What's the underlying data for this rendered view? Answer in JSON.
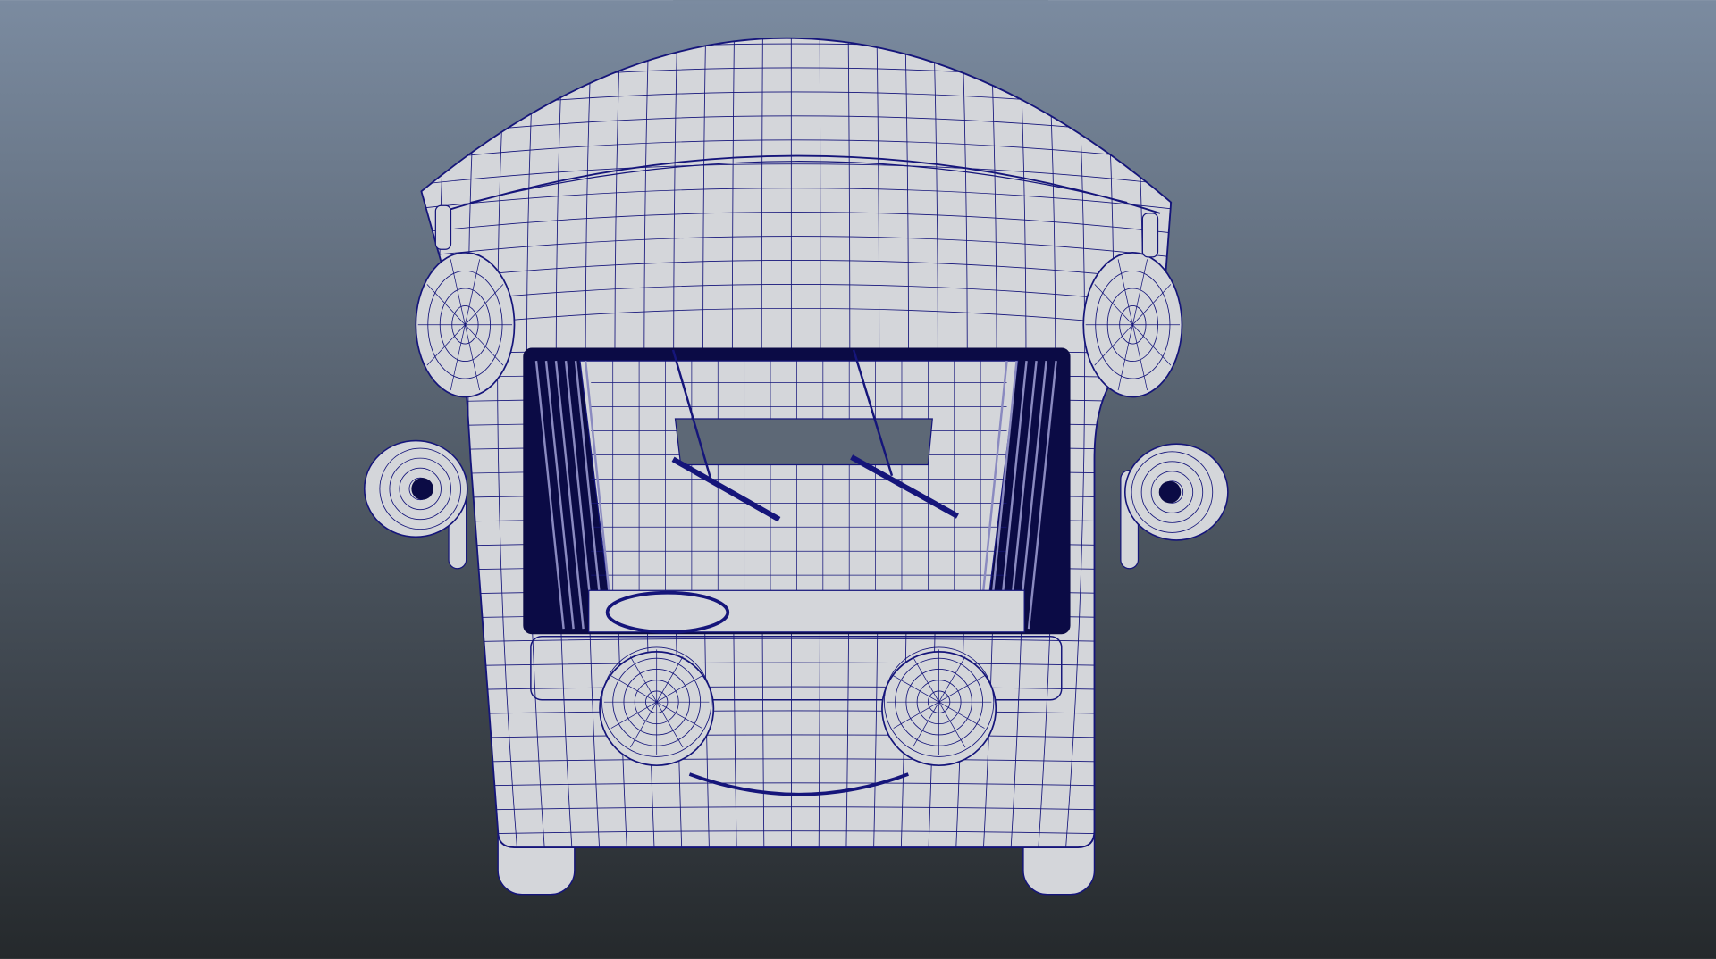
{
  "viewport": {
    "background_top": "#7b8ba0",
    "background_bottom": "#25292c",
    "model": {
      "display_mode": "wireframe-on-shaded",
      "surface_color": "#d4d6da",
      "wire_color": "#15157a",
      "cavity_color": "#0b0b45"
    }
  }
}
